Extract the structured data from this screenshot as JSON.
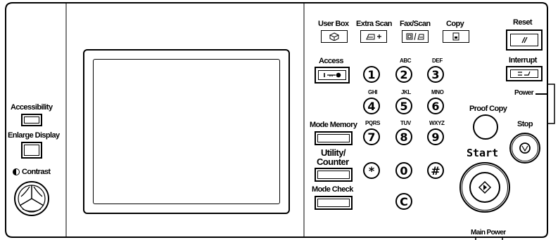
{
  "left": {
    "accessibility_label": "Accessibility",
    "enlarge_display_label": "Enlarge Display",
    "contrast_label": "Contrast"
  },
  "top_row": {
    "user_box": "User Box",
    "extra_scan": "Extra Scan",
    "fax_scan": "Fax/Scan",
    "copy": "Copy",
    "reset": "Reset"
  },
  "mid": {
    "access": "Access",
    "interrupt": "Interrupt",
    "power": "Power",
    "proof_copy": "Proof Copy",
    "stop": "Stop",
    "start": "Start",
    "mode_memory": "Mode Memory",
    "utility_line1": "Utility/",
    "utility_line2": "Counter",
    "mode_check": "Mode Check",
    "main_power": "Main Power"
  },
  "keypad": {
    "keys": [
      "1",
      "2",
      "3",
      "4",
      "5",
      "6",
      "7",
      "8",
      "9",
      "*",
      "0",
      "#",
      "C"
    ],
    "letters": {
      "k2": "ABC",
      "k3": "DEF",
      "k4": "GHI",
      "k5": "JKL",
      "k6": "MNO",
      "k7": "PQRS",
      "k8": "TUV",
      "k9": "WXYZ"
    }
  }
}
